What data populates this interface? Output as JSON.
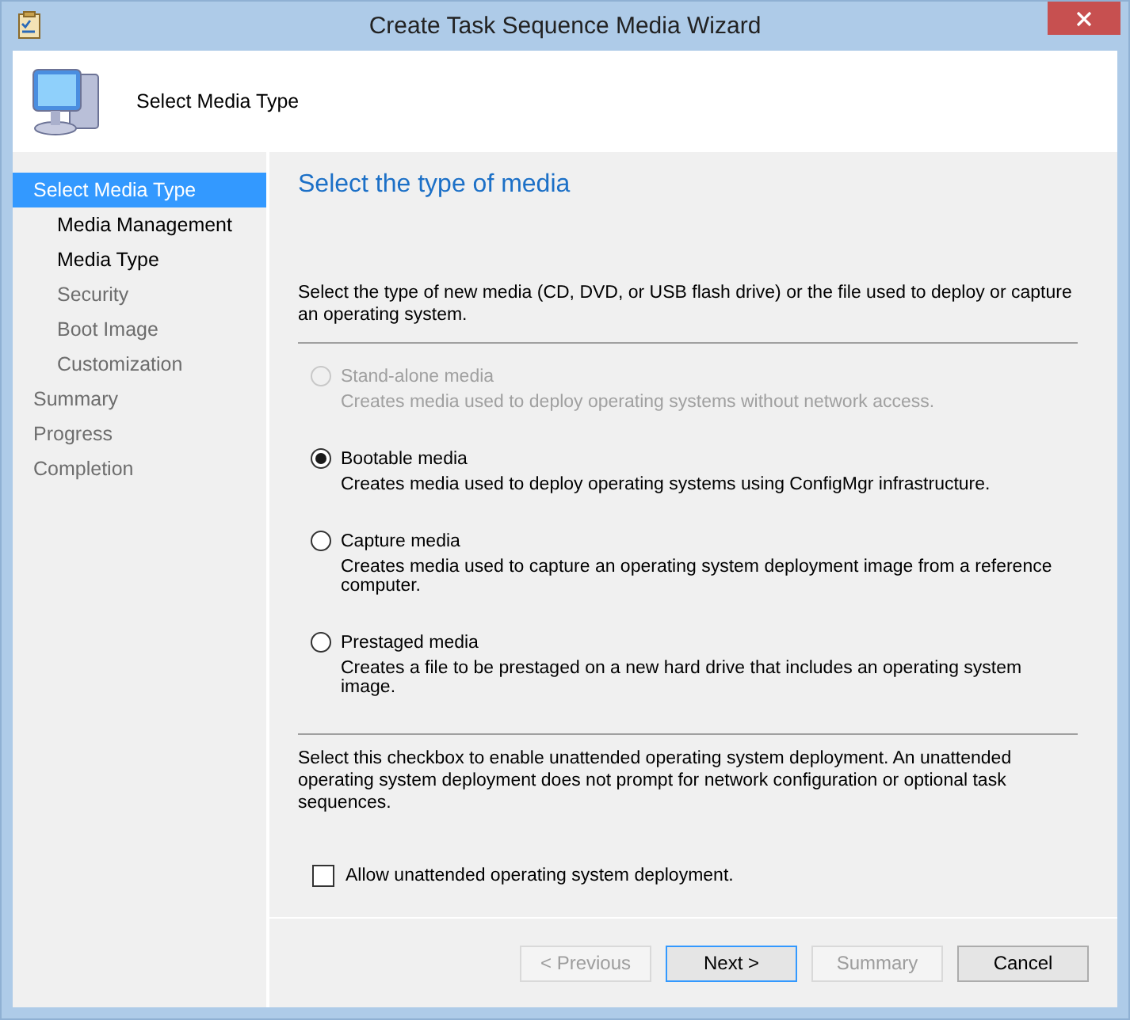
{
  "window": {
    "title": "Create Task Sequence Media Wizard"
  },
  "header": {
    "title": "Select Media Type"
  },
  "sidebar": {
    "items": [
      {
        "label": "Select Media Type",
        "selected": true,
        "visited": true,
        "children": [
          {
            "label": "Media Management",
            "selected": false,
            "visited": true
          },
          {
            "label": "Media Type",
            "selected": false,
            "visited": true
          },
          {
            "label": "Security",
            "selected": false,
            "visited": false
          },
          {
            "label": "Boot Image",
            "selected": false,
            "visited": false
          },
          {
            "label": "Customization",
            "selected": false,
            "visited": false
          }
        ]
      },
      {
        "label": "Summary",
        "selected": false,
        "visited": false
      },
      {
        "label": "Progress",
        "selected": false,
        "visited": false
      },
      {
        "label": "Completion",
        "selected": false,
        "visited": false
      }
    ]
  },
  "content": {
    "heading": "Select the type of media",
    "intro": "Select the type of new media (CD, DVD, or USB flash drive) or the file used to deploy or capture an operating system.",
    "options": [
      {
        "label": "Stand-alone media",
        "description": "Creates media used to deploy operating systems without network access.",
        "selected": false,
        "disabled": true
      },
      {
        "label": "Bootable media",
        "description": "Creates media used to deploy operating systems using ConfigMgr infrastructure.",
        "selected": true,
        "disabled": false
      },
      {
        "label": "Capture media",
        "description": "Creates media used to capture an operating system deployment image from a reference computer.",
        "selected": false,
        "disabled": false
      },
      {
        "label": "Prestaged media",
        "description": "Creates a file to be prestaged on a new hard drive that includes an operating system image.",
        "selected": false,
        "disabled": false
      }
    ],
    "unattended_note": "Select this checkbox to enable unattended operating system deployment. An unattended operating system deployment does not prompt for network configuration or optional task sequences.",
    "unattended_checkbox": {
      "label": "Allow unattended operating system deployment.",
      "checked": false
    }
  },
  "buttons": [
    {
      "label": "< Previous",
      "disabled": true,
      "default": false
    },
    {
      "label": "Next >",
      "disabled": false,
      "default": true
    },
    {
      "label": "Summary",
      "disabled": true,
      "default": false
    },
    {
      "label": "Cancel",
      "disabled": false,
      "default": false
    }
  ]
}
